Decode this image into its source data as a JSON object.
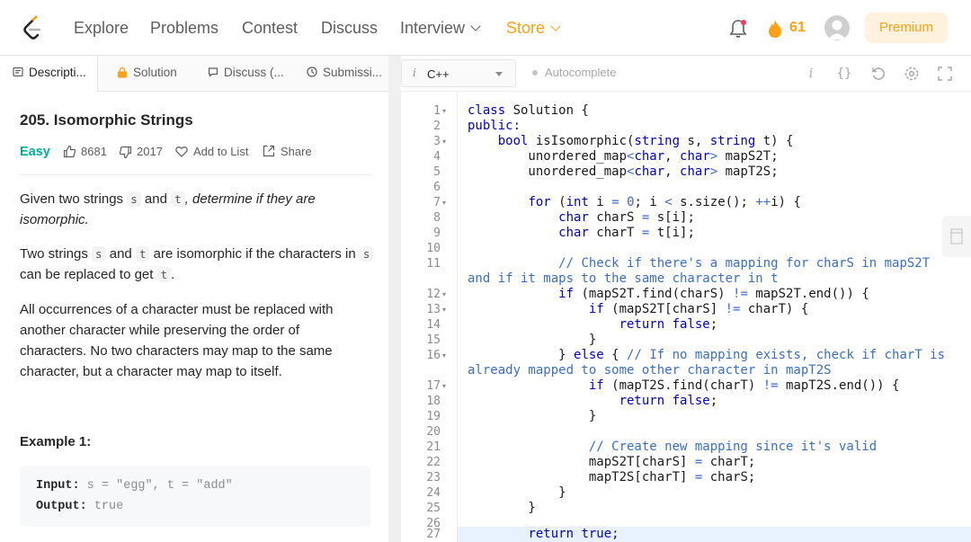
{
  "nav": {
    "items": [
      "Explore",
      "Problems",
      "Contest",
      "Discuss",
      "Interview"
    ],
    "store_label": "Store",
    "streak_count": "61",
    "premium_label": "Premium",
    "accent": "#ffa116"
  },
  "left_tabs": [
    "Descripti...",
    "Solution",
    "Discuss (...",
    "Submissi..."
  ],
  "problem": {
    "title": "205. Isomorphic Strings",
    "difficulty": "Easy",
    "likes": "8681",
    "dislikes": "2017",
    "add_to_list": "Add to List",
    "share": "Share",
    "p1": {
      "a": "Given two strings ",
      "s": "s",
      "b": " and ",
      "t": "t",
      "c": ", determine if they are isomorphic."
    },
    "p2": {
      "a": "Two strings ",
      "s": "s",
      "b": " and ",
      "t": "t",
      "c": " are isomorphic if the characters in ",
      "s2": "s",
      "d": " can be replaced to get ",
      "t2": "t",
      "e": "."
    },
    "p3_lines": [
      "All occurrences of a character must be replaced with",
      "another character while preserving the order of",
      "characters. No two characters may map to the same",
      "character, but a character may map to itself."
    ],
    "example_title": "Example 1:",
    "example": {
      "input_key": "Input:",
      "input_val": "s = \"egg\", t = \"add\"",
      "output_key": "Output:",
      "output_val": "true"
    }
  },
  "editor": {
    "language": "C++",
    "autocomplete_label": "Autocomplete",
    "line_numbers": [
      "1",
      "2",
      "3",
      "4",
      "5",
      "6",
      "7",
      "8",
      "9",
      "10",
      "11",
      "",
      "12",
      "13",
      "14",
      "15",
      "16",
      "",
      "17",
      "18",
      "19",
      "20",
      "21",
      "22",
      "23",
      "24",
      "25",
      "26",
      "27"
    ]
  }
}
